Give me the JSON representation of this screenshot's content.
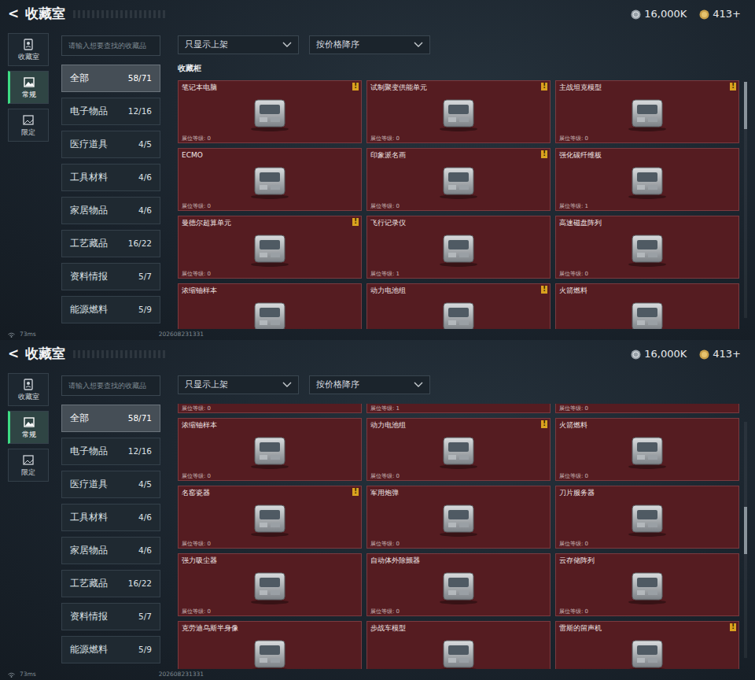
{
  "panels": [
    {
      "header": {
        "back": "<",
        "title": "收藏室",
        "currencies": [
          {
            "value": "16,000K"
          },
          {
            "value": "413+"
          }
        ]
      },
      "side_tabs": [
        {
          "label": "收藏室",
          "selected": false
        },
        {
          "label": "常规",
          "selected": true
        },
        {
          "label": "限定",
          "selected": false
        }
      ],
      "search": {
        "placeholder": "请输入想要查找的收藏品"
      },
      "categories": [
        {
          "label": "全部",
          "count": "58/71",
          "selected": true
        },
        {
          "label": "电子物品",
          "count": "12/16",
          "selected": false
        },
        {
          "label": "医疗道具",
          "count": "4/5",
          "selected": false
        },
        {
          "label": "工具材料",
          "count": "4/6",
          "selected": false
        },
        {
          "label": "家居物品",
          "count": "4/6",
          "selected": false
        },
        {
          "label": "工艺藏品",
          "count": "16/22",
          "selected": false
        },
        {
          "label": "资料情报",
          "count": "5/7",
          "selected": false
        },
        {
          "label": "能源燃料",
          "count": "5/9",
          "selected": false
        }
      ],
      "filters": [
        {
          "label": "只显示上架"
        },
        {
          "label": "按价格降序"
        }
      ],
      "section_title": "收藏柜",
      "items": [
        {
          "kind": "full",
          "name": "笔记本电脑",
          "level_label": "展位等级: 0",
          "badge": "!"
        },
        {
          "kind": "full",
          "name": "试制聚变供能单元",
          "level_label": "展位等级: 0",
          "badge": "!"
        },
        {
          "kind": "full",
          "name": "主战坦克模型",
          "level_label": "展位等级: 0",
          "badge": "!"
        },
        {
          "kind": "full",
          "name": "ECMO",
          "level_label": "展位等级: 0"
        },
        {
          "kind": "full",
          "name": "印象派名画",
          "level_label": "展位等级: 0",
          "badge": "!"
        },
        {
          "kind": "full",
          "name": "强化碳纤维板",
          "level_label": "展位等级: 1"
        },
        {
          "kind": "full",
          "name": "曼德尔超算单元",
          "level_label": "展位等级: 0",
          "badge": "!"
        },
        {
          "kind": "full",
          "name": "飞行记录仪",
          "level_label": "展位等级: 1"
        },
        {
          "kind": "full",
          "name": "高速磁盘阵列",
          "level_label": "展位等级: 0"
        },
        {
          "kind": "head",
          "name": "浓缩铀样本"
        },
        {
          "kind": "head",
          "name": "动力电池组",
          "badge": "!"
        },
        {
          "kind": "head",
          "name": "火箭燃料"
        }
      ],
      "scrollbar": {
        "level": 0
      },
      "status": {
        "ping": "73ms",
        "build": "202608231331"
      }
    },
    {
      "header": {
        "back": "<",
        "title": "收藏室",
        "currencies": [
          {
            "value": "16,000K"
          },
          {
            "value": "413+"
          }
        ]
      },
      "side_tabs": [
        {
          "label": "收藏室",
          "selected": false
        },
        {
          "label": "常规",
          "selected": true
        },
        {
          "label": "限定",
          "selected": false
        }
      ],
      "search": {
        "placeholder": "请输入想要查找的收藏品"
      },
      "categories": [
        {
          "label": "全部",
          "count": "58/71",
          "selected": true
        },
        {
          "label": "电子物品",
          "count": "12/16",
          "selected": false
        },
        {
          "label": "医疗道具",
          "count": "4/5",
          "selected": false
        },
        {
          "label": "工具材料",
          "count": "4/6",
          "selected": false
        },
        {
          "label": "家居物品",
          "count": "4/6",
          "selected": false
        },
        {
          "label": "工艺藏品",
          "count": "16/22",
          "selected": false
        },
        {
          "label": "资料情报",
          "count": "5/7",
          "selected": false
        },
        {
          "label": "能源燃料",
          "count": "5/9",
          "selected": false
        }
      ],
      "filters": [
        {
          "label": "只显示上架"
        },
        {
          "label": "按价格降序"
        }
      ],
      "items": [
        {
          "kind": "tail",
          "level_label": "展位等级: 0"
        },
        {
          "kind": "tail",
          "level_label": "展位等级: 1"
        },
        {
          "kind": "tail",
          "level_label": "展位等级: 0"
        },
        {
          "kind": "full",
          "name": "浓缩铀样本",
          "level_label": "展位等级: 0"
        },
        {
          "kind": "full",
          "name": "动力电池组",
          "level_label": "展位等级: 0",
          "badge": "!"
        },
        {
          "kind": "full",
          "name": "火箭燃料",
          "level_label": "展位等级: 0"
        },
        {
          "kind": "full",
          "name": "名窑瓷器",
          "level_label": "展位等级: 0",
          "badge": "!"
        },
        {
          "kind": "full",
          "name": "军用炮弹",
          "level_label": "展位等级: 0"
        },
        {
          "kind": "full",
          "name": "刀片服务器",
          "level_label": "展位等级: 0"
        },
        {
          "kind": "full",
          "name": "强力吸尘器",
          "level_label": "展位等级: 0"
        },
        {
          "kind": "full",
          "name": "自动体外除颤器",
          "level_label": "展位等级: 0"
        },
        {
          "kind": "full",
          "name": "云存储阵列",
          "level_label": "展位等级: 0"
        },
        {
          "kind": "head",
          "name": "克劳迪乌斯半身像"
        },
        {
          "kind": "head",
          "name": "步战车模型"
        },
        {
          "kind": "head",
          "name": "雷斯的留声机",
          "badge": "!"
        }
      ],
      "scrollbar": {
        "level": 0.45
      },
      "status": {
        "ping": "73ms",
        "build": "202608231331"
      }
    }
  ]
}
